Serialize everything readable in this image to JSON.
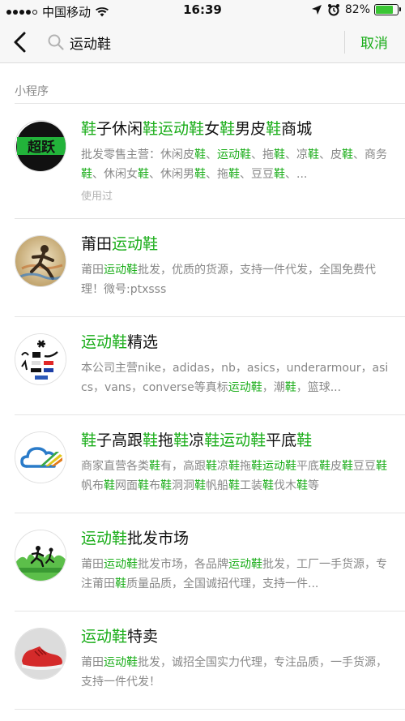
{
  "status_bar": {
    "carrier": "中国移动",
    "time": "16:39",
    "battery_percent": "82%",
    "battery_level": 0.82
  },
  "search": {
    "query": "运动鞋",
    "cancel_label": "取消"
  },
  "section": {
    "title": "小程序"
  },
  "results": [
    {
      "title_segments": [
        [
          "鞋",
          1
        ],
        [
          "子休闲",
          0
        ],
        [
          "鞋",
          1
        ],
        [
          "运动鞋",
          1
        ],
        [
          "女",
          0
        ],
        [
          "鞋",
          1
        ],
        [
          "男皮",
          0
        ],
        [
          "鞋",
          1
        ],
        [
          "商城",
          0
        ]
      ],
      "desc_segments": [
        [
          "批发零售主营：休闲皮",
          0
        ],
        [
          "鞋",
          1
        ],
        [
          "、",
          0
        ],
        [
          "运动鞋",
          1
        ],
        [
          "、拖",
          0
        ],
        [
          "鞋",
          1
        ],
        [
          "、凉",
          0
        ],
        [
          "鞋",
          1
        ],
        [
          "、皮",
          0
        ],
        [
          "鞋",
          1
        ],
        [
          "、商务",
          0
        ],
        [
          "鞋",
          1
        ],
        [
          "、休闲女",
          0
        ],
        [
          "鞋",
          1
        ],
        [
          "、休闲男",
          0
        ],
        [
          "鞋",
          1
        ],
        [
          "、拖",
          0
        ],
        [
          "鞋",
          1
        ],
        [
          "、豆豆",
          0
        ],
        [
          "鞋",
          1
        ],
        [
          "、...",
          0
        ]
      ],
      "used_label": "使用过",
      "avatar_icon": "chaoyue-logo-icon",
      "avatar_text": "超跃"
    },
    {
      "title_segments": [
        [
          "莆田",
          0
        ],
        [
          "运动鞋",
          1
        ]
      ],
      "desc_segments": [
        [
          "莆田",
          0
        ],
        [
          "运动鞋",
          1
        ],
        [
          "批发，优质的货源，支持一件代发，全国免费代理！微号:ptxsss",
          0
        ]
      ],
      "avatar_icon": "runner-icon"
    },
    {
      "title_segments": [
        [
          "运动鞋",
          1
        ],
        [
          "精选",
          0
        ]
      ],
      "desc_segments": [
        [
          "本公司主营nike，adidas，nb，asics，underarmour，asics，vans，converse等真标",
          0
        ],
        [
          "运动鞋",
          1
        ],
        [
          "，潮",
          0
        ],
        [
          "鞋",
          1
        ],
        [
          "，篮球...",
          0
        ]
      ],
      "avatar_icon": "sports-brands-icon"
    },
    {
      "title_segments": [
        [
          "鞋",
          1
        ],
        [
          "子高跟",
          0
        ],
        [
          "鞋",
          1
        ],
        [
          "拖",
          0
        ],
        [
          "鞋",
          1
        ],
        [
          "凉",
          0
        ],
        [
          "鞋",
          1
        ],
        [
          "运动鞋",
          1
        ],
        [
          "平底",
          0
        ],
        [
          "鞋",
          1
        ]
      ],
      "desc_segments": [
        [
          "商家直营各类",
          0
        ],
        [
          "鞋",
          1
        ],
        [
          "有，高跟",
          0
        ],
        [
          "鞋",
          1
        ],
        [
          "凉",
          0
        ],
        [
          "鞋",
          1
        ],
        [
          "拖",
          0
        ],
        [
          "鞋",
          1
        ],
        [
          "运动鞋",
          1
        ],
        [
          "平底",
          0
        ],
        [
          "鞋",
          1
        ],
        [
          "皮",
          0
        ],
        [
          "鞋",
          1
        ],
        [
          "豆豆",
          0
        ],
        [
          "鞋",
          1
        ],
        [
          "帆布",
          0
        ],
        [
          "鞋",
          1
        ],
        [
          "网面",
          0
        ],
        [
          "鞋",
          1
        ],
        [
          "布",
          0
        ],
        [
          "鞋",
          1
        ],
        [
          "洞洞",
          0
        ],
        [
          "鞋",
          1
        ],
        [
          "帆船",
          0
        ],
        [
          "鞋",
          1
        ],
        [
          "工装",
          0
        ],
        [
          "鞋",
          1
        ],
        [
          "伐木",
          0
        ],
        [
          "鞋",
          1
        ],
        [
          "等",
          0
        ]
      ],
      "avatar_icon": "cloud-logo-icon"
    },
    {
      "title_segments": [
        [
          "运动鞋",
          1
        ],
        [
          "批发市场",
          0
        ]
      ],
      "desc_segments": [
        [
          "莆田",
          0
        ],
        [
          "运动鞋",
          1
        ],
        [
          "批发市场，各品牌",
          0
        ],
        [
          "运动鞋",
          1
        ],
        [
          "批发，工厂一手货源，专注莆田",
          0
        ],
        [
          "鞋",
          1
        ],
        [
          "质量品质，全国诚招代理，支持一件...",
          0
        ]
      ],
      "avatar_icon": "runners-crowd-icon"
    },
    {
      "title_segments": [
        [
          "运动鞋",
          1
        ],
        [
          "特卖",
          0
        ]
      ],
      "desc_segments": [
        [
          "莆田",
          0
        ],
        [
          "运动鞋",
          1
        ],
        [
          "批发，诚招全国实力代理，专注品质，一手货源，支持一件代发！",
          0
        ]
      ],
      "avatar_icon": "red-sneaker-icon"
    }
  ],
  "colors": {
    "accent": "#1aad19",
    "muted_text": "#888888",
    "background": "#efeff4"
  }
}
